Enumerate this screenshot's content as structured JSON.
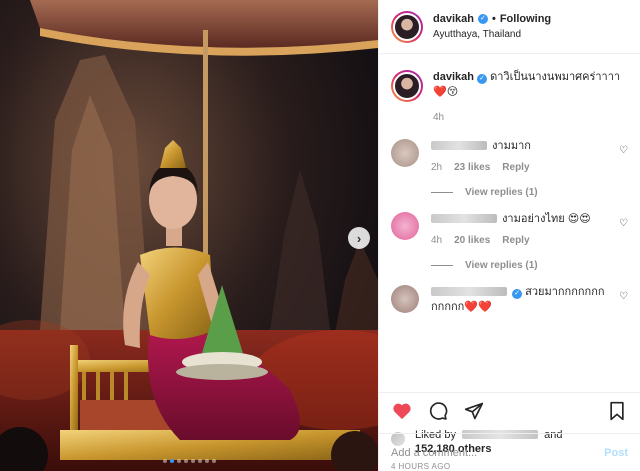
{
  "header": {
    "username": "davikah",
    "separator": "•",
    "follow_label": "Following",
    "location": "Ayutthaya, Thailand"
  },
  "caption": {
    "username": "davikah",
    "text": "ดาวิเป็นนางนพมาศคร่าาาา",
    "emoji": "❤️😚",
    "time": "4h"
  },
  "comments": [
    {
      "text": "งามมาก",
      "time": "2h",
      "likes": "23 likes",
      "reply_label": "Reply",
      "view_replies": "View replies (1)",
      "avatar_color": "#c9b3a8"
    },
    {
      "text": "งามอย่างไทย 😍😍",
      "time": "4h",
      "likes": "20 likes",
      "reply_label": "Reply",
      "view_replies": "View replies (1)",
      "avatar_color": "#e78ab4"
    },
    {
      "text": "สวยมากกกกกกกกกกกก❤️❤️",
      "avatar_color": "#b9a39c"
    }
  ],
  "likes": {
    "prefix": "Liked by",
    "suffix": "and",
    "others": "152,180 others"
  },
  "timestamp": "4 HOURS AGO",
  "comment_box": {
    "placeholder": "Add a comment...",
    "post_label": "Post"
  },
  "icons": [
    "verified-icon",
    "heart-icon",
    "comment-icon",
    "share-icon",
    "bookmark-icon",
    "next-arrow-icon"
  ],
  "colors": {
    "accent": "#3897f0",
    "like_red": "#ed4956",
    "post_disabled": "#b2dffc"
  }
}
